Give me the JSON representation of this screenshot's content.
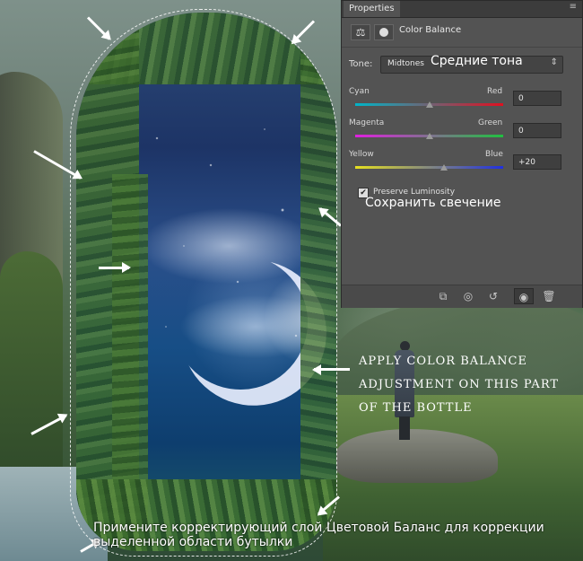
{
  "panel": {
    "tab_label": "Properties",
    "close_glyph": "×",
    "menu_glyph": "≡",
    "adjustment_title": "Color Balance",
    "icons": [
      "balance-scale-icon",
      "layer-mask-icon"
    ],
    "tone": {
      "label": "Tone:",
      "value": "Midtones",
      "translation": "Средние тона"
    },
    "sliders": [
      {
        "left_label": "Cyan",
        "right_label": "Red",
        "value": "0",
        "position": 0.5,
        "colors": [
          "#00b4c8",
          "#e01020"
        ]
      },
      {
        "left_label": "Magenta",
        "right_label": "Green",
        "value": "0",
        "position": 0.5,
        "colors": [
          "#e020e0",
          "#20c040"
        ]
      },
      {
        "left_label": "Yellow",
        "right_label": "Blue",
        "value": "+20",
        "position": 0.6,
        "colors": [
          "#e6e020",
          "#2030e0"
        ]
      }
    ],
    "preserve_luminosity": {
      "label": "Preserve Luminosity",
      "checked": true,
      "translation": "Сохранить свечение"
    },
    "footer_icons": [
      "clip-to-layer-icon",
      "view-previous-icon",
      "reset-icon",
      "visibility-eye-icon",
      "trash-icon"
    ]
  },
  "captions": {
    "english": [
      "APPLY COLOR BALANCE",
      "ADJUSTMENT ON THIS PART",
      "OF THE BOTTLE"
    ],
    "russian": "Примените корректирующий слой Цветовой Баланс для коррекции выделенной области бутылки"
  }
}
